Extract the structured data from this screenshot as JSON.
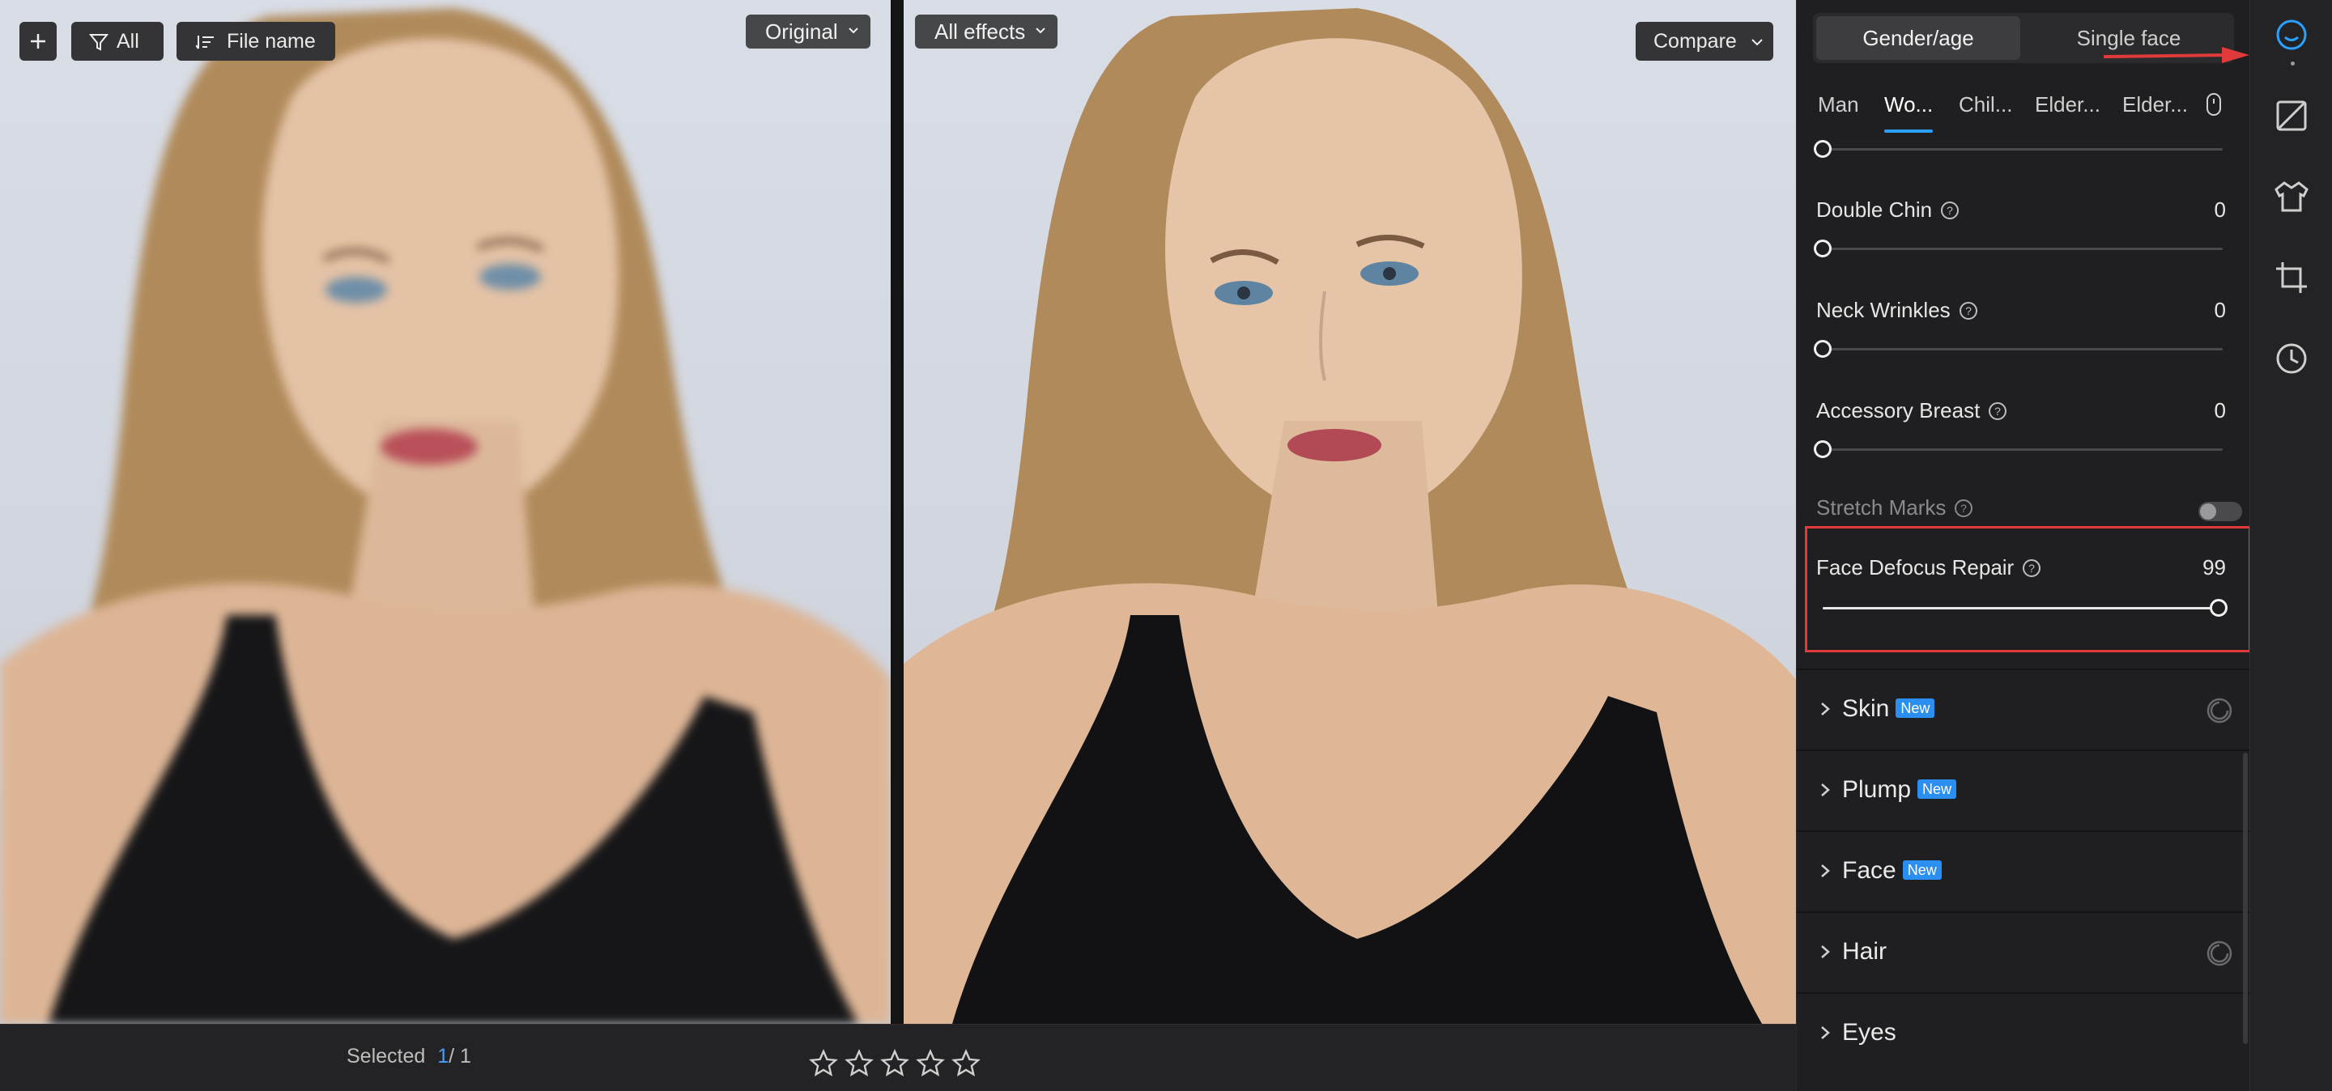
{
  "viewer": {
    "left_pane": {
      "dropdown_label": "Original"
    },
    "right_pane": {
      "dropdown_label": "All effects"
    }
  },
  "bottom_bar": {
    "filter_label": "All",
    "sort_label": "File name",
    "selected_label": "Selected",
    "selected_count": "1",
    "selected_total": "/ 1",
    "rating_stars": 5,
    "compare_label": "Compare"
  },
  "panel": {
    "mode_tabs": [
      "Gender/age",
      "Single face"
    ],
    "active_mode": "Gender/age",
    "subtabs": [
      "Man",
      "Wo...",
      "Chil...",
      "Elder...",
      "Elder..."
    ],
    "active_subtab": "Wo...",
    "sliders": [
      {
        "label": "Double Chin",
        "value": "0"
      },
      {
        "label": "Neck Wrinkles",
        "value": "0"
      },
      {
        "label": "Accessory Breast",
        "value": "0"
      }
    ],
    "stretch_marks": {
      "label": "Stretch Marks",
      "enabled": false
    },
    "face_defocus": {
      "label": "Face Defocus Repair",
      "value": "99",
      "fraction": 0.99
    },
    "sections": [
      {
        "title": "Skin",
        "badge": "New"
      },
      {
        "title": "Plump",
        "badge": "New"
      },
      {
        "title": "Face",
        "badge": "New"
      },
      {
        "title": "Hair",
        "badge": ""
      },
      {
        "title": "Eyes",
        "badge": ""
      }
    ]
  },
  "rail": [
    "face-retouch-icon",
    "adjust-icon",
    "clothing-icon",
    "crop-icon",
    "history-icon"
  ],
  "colors": {
    "accent": "#2aa0ff",
    "highlight": "#e03a3a",
    "badge": "#2a8ff0"
  }
}
